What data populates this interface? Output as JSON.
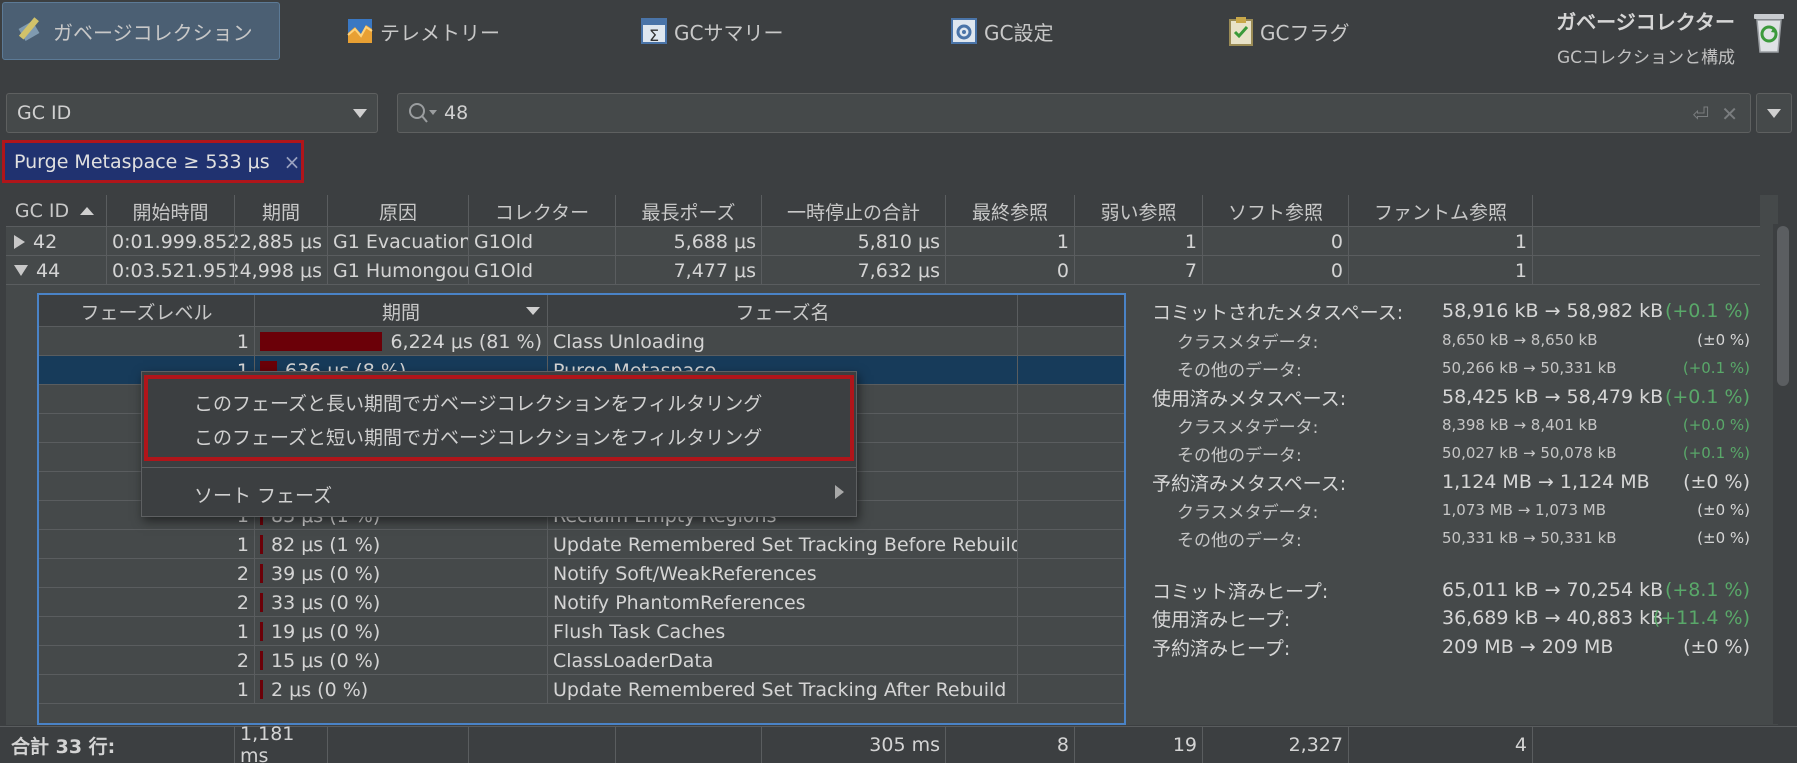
{
  "toolbar": {
    "tabs": [
      {
        "label": "ガベージコレクション",
        "icon": "garbage-collection-icon"
      },
      {
        "label": "テレメトリー",
        "icon": "telemetry-icon"
      },
      {
        "label": "GCサマリー",
        "icon": "gc-summary-icon"
      },
      {
        "label": "GC設定",
        "icon": "gc-settings-icon"
      },
      {
        "label": "GCフラグ",
        "icon": "gc-flags-icon"
      }
    ],
    "title": "ガベージコレクター",
    "subtitle": "GCコレクションと構成"
  },
  "filter": {
    "combo_value": "GC ID",
    "search_value": "48",
    "chip_label": "Purge Metaspace ≥ 533 μs",
    "chip_close": "×"
  },
  "gc_table": {
    "columns": [
      "GC ID",
      "開始時間",
      "期間",
      "原因",
      "コレクター",
      "最長ポーズ",
      "一時停止の合計",
      "最終参照",
      "弱い参照",
      "ソフト参照",
      "ファントム参照"
    ],
    "rows": [
      {
        "id": "42",
        "start": "0:01.999.852",
        "start_more": "[...",
        "duration": "22,885 μs",
        "cause": "G1 Evacuation ...",
        "collector": "G1Old",
        "longest": "5,688 μs",
        "total": "5,810 μs",
        "final": "1",
        "weak": "1",
        "soft": "0",
        "phantom": "1"
      },
      {
        "id": "44",
        "start": "0:03.521.951",
        "start_more": "[...",
        "duration": "24,998 μs",
        "cause": "G1 Humongou...",
        "collector": "G1Old",
        "longest": "7,477 μs",
        "total": "7,632 μs",
        "final": "0",
        "weak": "7",
        "soft": "0",
        "phantom": "1"
      }
    ]
  },
  "phase_table": {
    "columns": [
      "フェーズレベル",
      "期間",
      "フェーズ名"
    ],
    "rows": [
      {
        "level": "1",
        "duration": "6,224 μs (81 %)",
        "fraction": 0.81,
        "name": "Class Unloading"
      },
      {
        "level": "1",
        "duration": "636 μs (8 %)",
        "fraction": 0.08,
        "name": "Purge Metaspace"
      },
      {
        "level": "",
        "duration": "",
        "fraction": 0,
        "name": ""
      },
      {
        "level": "",
        "duration": "",
        "fraction": 0,
        "name": "anup"
      },
      {
        "level": "",
        "duration": "",
        "fraction": 0,
        "name": ""
      },
      {
        "level": "",
        "duration": "",
        "fraction": 0,
        "name": ""
      },
      {
        "level": "1",
        "duration": "83 μs (1 %)",
        "fraction": 0.01,
        "name": "Reclaim Empty Regions"
      },
      {
        "level": "1",
        "duration": "82 μs (1 %)",
        "fraction": 0.01,
        "name": "Update Remembered Set Tracking Before Rebuild"
      },
      {
        "level": "2",
        "duration": "39 μs (0 %)",
        "fraction": 0,
        "name": "Notify Soft/WeakReferences"
      },
      {
        "level": "2",
        "duration": "33 μs (0 %)",
        "fraction": 0,
        "name": "Notify PhantomReferences"
      },
      {
        "level": "1",
        "duration": "19 μs (0 %)",
        "fraction": 0,
        "name": "Flush Task Caches"
      },
      {
        "level": "2",
        "duration": "15 μs (0 %)",
        "fraction": 0,
        "name": "ClassLoaderData"
      },
      {
        "level": "1",
        "duration": "2 μs (0 %)",
        "fraction": 0,
        "name": "Update Remembered Set Tracking After Rebuild"
      }
    ]
  },
  "context_menu": {
    "items": [
      "このフェーズと長い期間でガベージコレクションをフィルタリング",
      "このフェーズと短い期間でガベージコレクションをフィルタリング"
    ],
    "submenu": "ソート フェーズ"
  },
  "details": {
    "rows": [
      {
        "label": "コミットされたメタスペース:",
        "value": "58,916 kB → 58,982 kB",
        "pct": "(+0.1 %)",
        "green": true,
        "sub": false
      },
      {
        "label": "クラスメタデータ:",
        "value": "8,650 kB → 8,650 kB",
        "pct": "(±0 %)",
        "green": false,
        "sub": true
      },
      {
        "label": "その他のデータ:",
        "value": "50,266 kB → 50,331 kB",
        "pct": "(+0.1 %)",
        "green": true,
        "sub": true
      },
      {
        "label": "使用済みメタスペース:",
        "value": "58,425 kB → 58,479 kB",
        "pct": "(+0.1 %)",
        "green": true,
        "sub": false
      },
      {
        "label": "クラスメタデータ:",
        "value": "8,398 kB → 8,401 kB",
        "pct": "(+0.0 %)",
        "green": true,
        "sub": true
      },
      {
        "label": "その他のデータ:",
        "value": "50,027 kB → 50,078 kB",
        "pct": "(+0.1 %)",
        "green": true,
        "sub": true
      },
      {
        "label": "予約済みメタスペース:",
        "value": "1,124 MB → 1,124 MB",
        "pct": "(±0 %)",
        "green": false,
        "sub": false
      },
      {
        "label": "クラスメタデータ:",
        "value": "1,073 MB → 1,073 MB",
        "pct": "(±0 %)",
        "green": false,
        "sub": true
      },
      {
        "label": "その他のデータ:",
        "value": "50,331 kB → 50,331 kB",
        "pct": "(±0 %)",
        "green": false,
        "sub": true
      },
      {
        "label": "コミット済みヒープ:",
        "value": "65,011 kB → 70,254 kB",
        "pct": "(+8.1 %)",
        "green": true,
        "sub": false
      },
      {
        "label": "使用済みヒープ:",
        "value": "36,689 kB → 40,883 kB",
        "pct": "(+11.4 %)",
        "green": true,
        "sub": false
      },
      {
        "label": "予約済みヒープ:",
        "value": "209 MB → 209 MB",
        "pct": "(±0 %)",
        "green": false,
        "sub": false
      }
    ]
  },
  "footer": {
    "label": "合計 33 行:",
    "duration": "1,181 ms",
    "total": "305 ms",
    "final": "8",
    "weak": "19",
    "soft": "2,327",
    "phantom": "4"
  },
  "colors": {
    "background": "#3c3f41",
    "table_bg": "#45494a",
    "selection": "#173b5a",
    "bar": "#6b0008",
    "highlight_border": "#b0151a",
    "chip_bg": "#203270",
    "green": "#59a869"
  }
}
